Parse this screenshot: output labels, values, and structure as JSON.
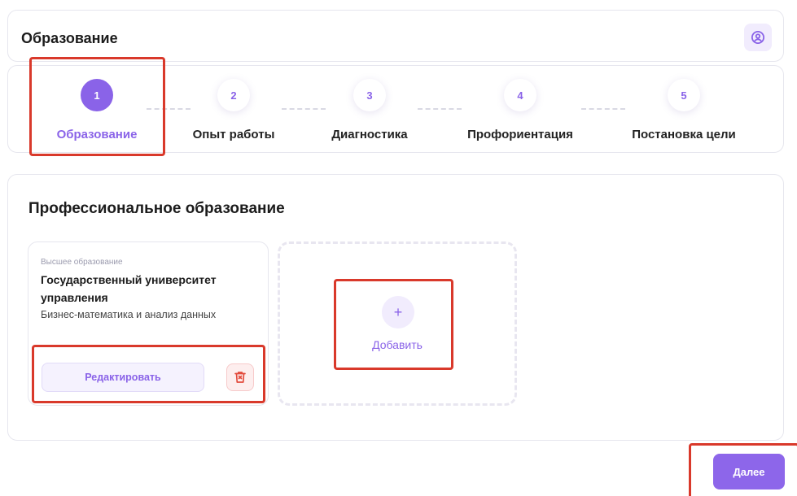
{
  "header": {
    "title": "Образование",
    "profile_icon": "user-circle-icon"
  },
  "stepper": {
    "active_step": 1,
    "steps": [
      {
        "number": "1",
        "label": "Образование"
      },
      {
        "number": "2",
        "label": "Опыт работы"
      },
      {
        "number": "3",
        "label": "Диагностика"
      },
      {
        "number": "4",
        "label": "Профориентация"
      },
      {
        "number": "5",
        "label": "Постановка цели"
      }
    ]
  },
  "section": {
    "title": "Профессиональное образование",
    "education_card": {
      "level": "Высшее образование",
      "institution": "Государственный университет управления",
      "specialty": "Бизнес-математика и анализ данных",
      "edit_label": "Редактировать",
      "delete_icon": "trash-icon"
    },
    "add_card": {
      "icon": "plus-icon",
      "label": "Добавить"
    }
  },
  "footer": {
    "next_label": "Далее"
  },
  "colors": {
    "accent": "#8a63e8",
    "danger": "#e24a3b",
    "highlight": "#d9392b"
  }
}
